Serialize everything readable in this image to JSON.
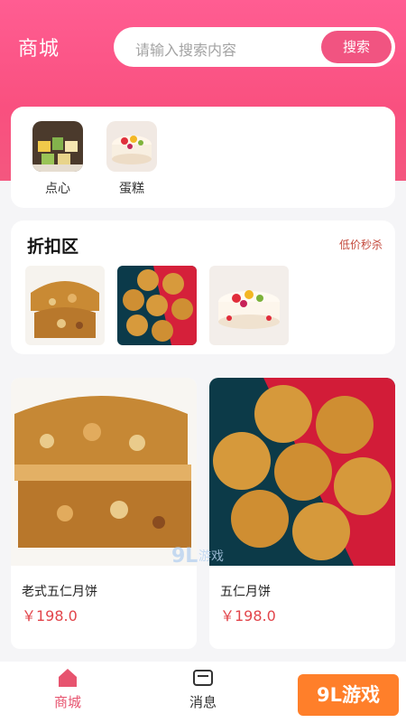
{
  "header": {
    "title": "商城",
    "search_placeholder": "请输入搜索内容",
    "search_button": "搜索",
    "accent_color": "#f9507f"
  },
  "categories": [
    {
      "label": "点心",
      "icon": "dim-sum-image"
    },
    {
      "label": "蛋糕",
      "icon": "cake-image"
    }
  ],
  "discount": {
    "title": "折扣区",
    "link": "低价秒杀",
    "images": [
      "mooncake-half-image",
      "mooncakes-group-image",
      "fruit-cake-image"
    ]
  },
  "products": [
    {
      "name": "老式五仁月饼",
      "price": "￥198.0"
    },
    {
      "name": "五仁月饼",
      "price": "￥198.0"
    }
  ],
  "tabbar": {
    "items": [
      {
        "label": "商城",
        "icon": "home-icon",
        "active": true
      },
      {
        "label": "消息",
        "icon": "message-icon",
        "active": false
      }
    ]
  },
  "watermark": {
    "text": "9L游戏",
    "mid_text": "9L游戏"
  }
}
